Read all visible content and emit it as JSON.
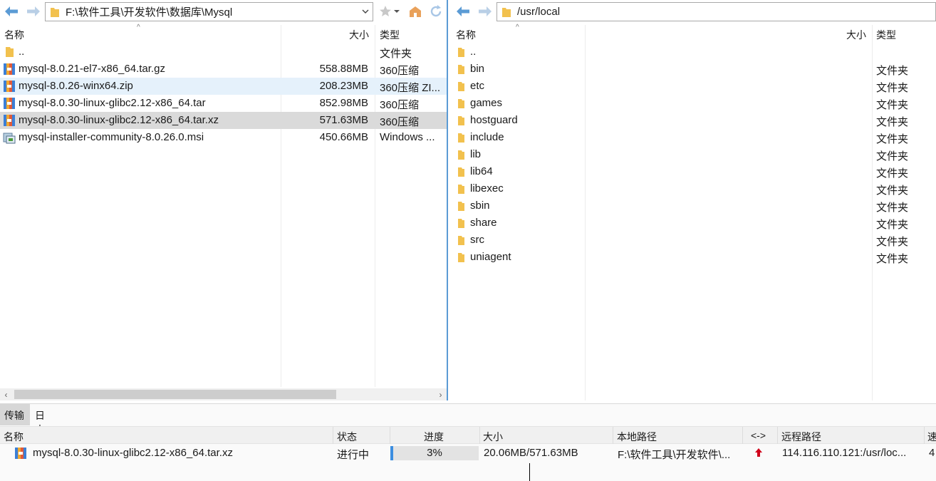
{
  "left": {
    "path": "F:\\软件工具\\开发软件\\数据库\\Mysql",
    "headers": {
      "name": "名称",
      "size": "大小",
      "type": "类型"
    },
    "files": [
      {
        "name": "..",
        "size": "",
        "type": "文件夹",
        "icon": "folder-icon"
      },
      {
        "name": "mysql-8.0.21-el7-x86_64.tar.gz",
        "size": "558.88MB",
        "type": "360压缩",
        "icon": "archive-icon"
      },
      {
        "name": "mysql-8.0.26-winx64.zip",
        "size": "208.23MB",
        "type": "360压缩 ZI...",
        "icon": "archive-icon"
      },
      {
        "name": "mysql-8.0.30-linux-glibc2.12-x86_64.tar",
        "size": "852.98MB",
        "type": "360压缩",
        "icon": "archive-icon"
      },
      {
        "name": "mysql-8.0.30-linux-glibc2.12-x86_64.tar.xz",
        "size": "571.63MB",
        "type": "360压缩",
        "icon": "archive-icon"
      },
      {
        "name": "mysql-installer-community-8.0.26.0.msi",
        "size": "450.66MB",
        "type": "Windows ...",
        "icon": "installer-icon"
      }
    ]
  },
  "right": {
    "path": "/usr/local",
    "headers": {
      "name": "名称",
      "size": "大小",
      "type": "类型"
    },
    "files": [
      {
        "name": "..",
        "type": ""
      },
      {
        "name": "bin",
        "type": "文件夹"
      },
      {
        "name": "etc",
        "type": "文件夹"
      },
      {
        "name": "games",
        "type": "文件夹"
      },
      {
        "name": "hostguard",
        "type": "文件夹"
      },
      {
        "name": "include",
        "type": "文件夹"
      },
      {
        "name": "lib",
        "type": "文件夹"
      },
      {
        "name": "lib64",
        "type": "文件夹"
      },
      {
        "name": "libexec",
        "type": "文件夹"
      },
      {
        "name": "sbin",
        "type": "文件夹"
      },
      {
        "name": "share",
        "type": "文件夹"
      },
      {
        "name": "src",
        "type": "文件夹"
      },
      {
        "name": "uniagent",
        "type": "文件夹"
      }
    ]
  },
  "bottom": {
    "tabs": [
      "传输",
      "日志"
    ],
    "headers": {
      "name": "名称",
      "status": "状态",
      "progress": "进度",
      "size": "大小",
      "local": "本地路径",
      "dir": "<->",
      "remote": "远程路径",
      "speed": "速"
    },
    "transfer": {
      "name": "mysql-8.0.30-linux-glibc2.12-x86_64.tar.xz",
      "status": "进行中",
      "progress_text": "3%",
      "progress_fraction": 0.03,
      "size": "20.06MB/571.63MB",
      "local": "F:\\软件工具\\开发软件\\...",
      "remote": "114.116.110.121:/usr/loc...",
      "speed": "4"
    }
  },
  "colors": {
    "accent": "#3c8ee0",
    "folder": "#f2c14e",
    "upload_arrow": "#d0021b",
    "selected_light": "#e5f1fb",
    "selected_gray": "#dadada"
  }
}
